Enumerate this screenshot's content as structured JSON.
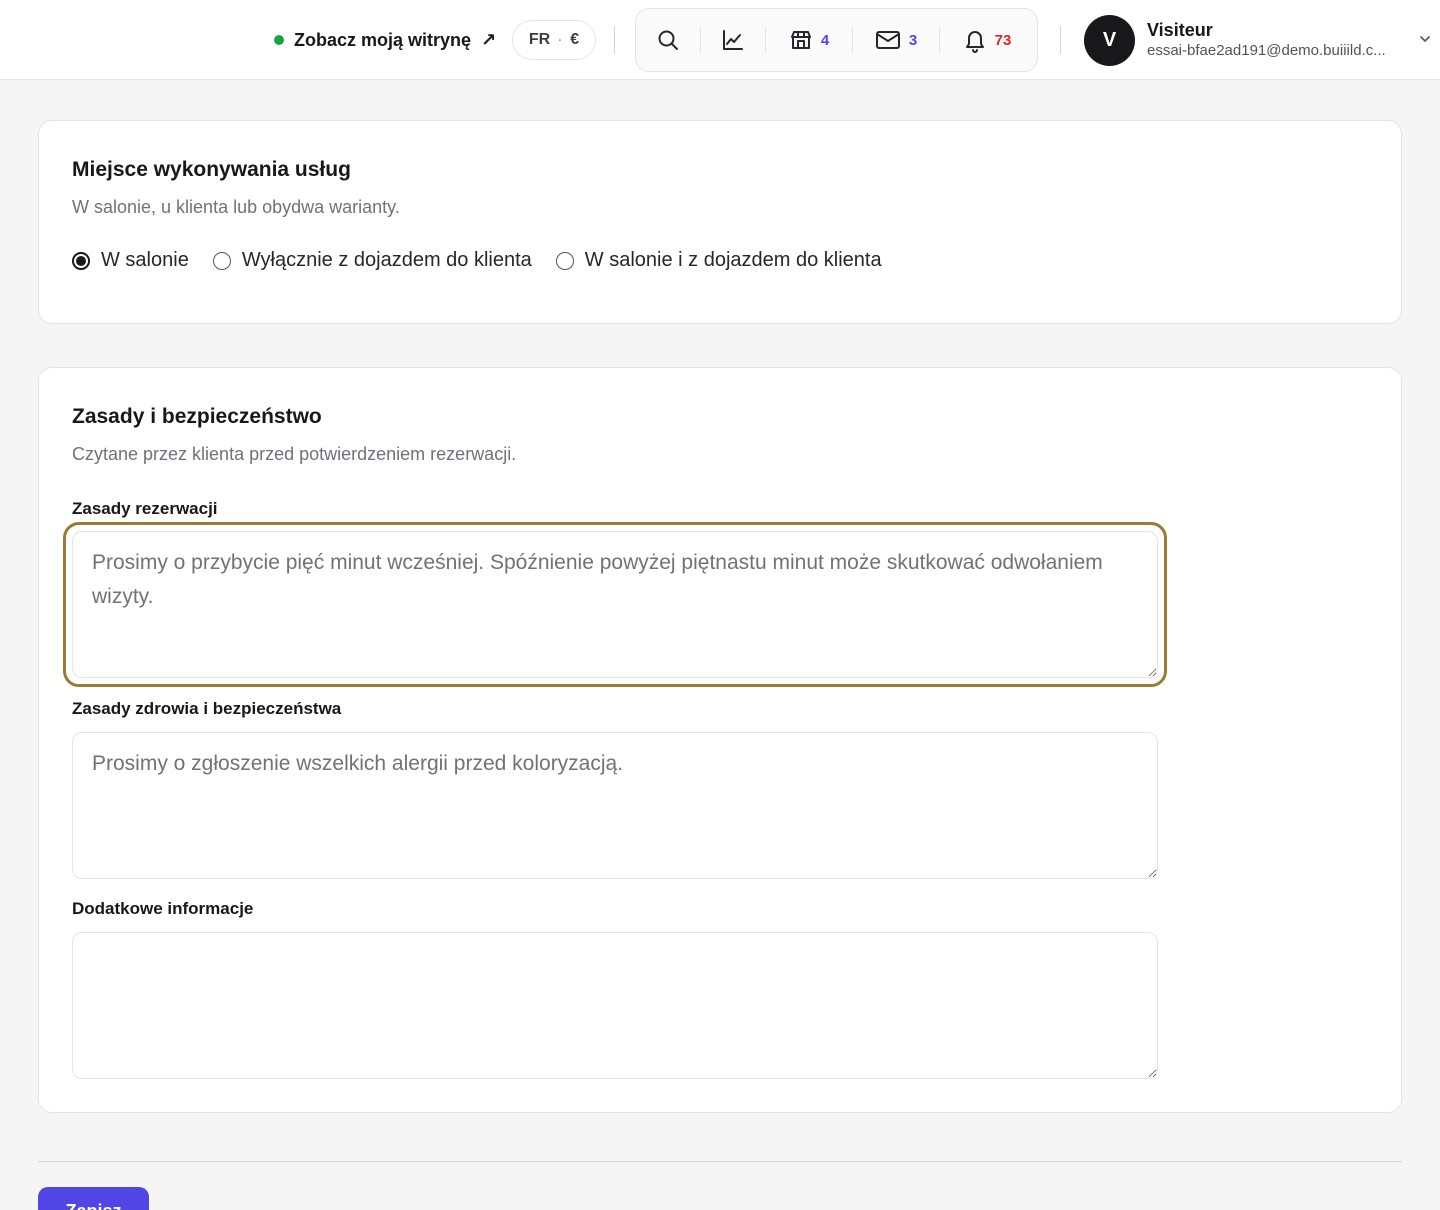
{
  "header": {
    "site_link": "Zobacz moją witrynę",
    "site_link_arrow": "↗",
    "locale_lang": "FR",
    "locale_sep": "·",
    "locale_currency": "€",
    "icons": {
      "search": "search-icon",
      "stats": "chart-line-icon",
      "store": "store-icon",
      "mail": "mail-icon",
      "bell": "bell-icon"
    },
    "store_count": "4",
    "mail_count": "3",
    "notif_count": "73",
    "user": {
      "initial": "V",
      "name": "Visiteur",
      "email": "essai-bfae2ad191@demo.buiiild.c..."
    }
  },
  "location_card": {
    "title": "Miejsce wykonywania usług",
    "subtitle": "W salonie, u klienta lub obydwa warianty.",
    "options": [
      {
        "label": "W salonie",
        "selected": true
      },
      {
        "label": "Wyłącznie z dojazdem do klienta",
        "selected": false
      },
      {
        "label": "W salonie i z dojazdem do klienta",
        "selected": false
      }
    ]
  },
  "policies_card": {
    "title": "Zasady i bezpieczeństwo",
    "subtitle": "Czytane przez klienta przed potwierdzeniem rezerwacji.",
    "booking_label": "Zasady rezerwacji",
    "booking_placeholder": "Prosimy o przybycie pięć minut wcześniej. Spóźnienie powyżej piętnastu minut może skutkować odwołaniem wizyty.",
    "health_label": "Zasady zdrowia i bezpieczeństwa",
    "health_placeholder": "Prosimy o zgłoszenie wszelkich alergii przed koloryzacją.",
    "extra_label": "Dodatkowe informacje",
    "extra_placeholder": ""
  },
  "footer": {
    "save_label": "Zapisz"
  },
  "colors": {
    "accent": "#4f46e5",
    "status_green": "#16a34a",
    "badge_red": "#dc2626",
    "focus_ring": "#9a7b34"
  }
}
